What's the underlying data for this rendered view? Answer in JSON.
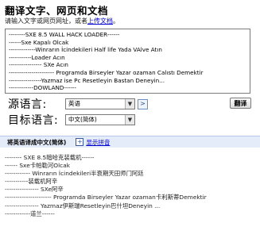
{
  "title": "翻译文字、网页和文档",
  "instructions": {
    "prefix": "请输入文字或网页网址，或者",
    "link": "上传文档",
    "suffix": "。"
  },
  "source_lines": [
    "--------SXE 8.5 WALL HACK LOADER------",
    "------Sxe Kapalı Olcak",
    "-------------Winrarın İcindekileri Half life Yada VAlve Atın",
    "-----------Loader Acın",
    "---------------- SXe Acın",
    "---------------------- Programda Birseyler Yazar ozaman Calıstı Demektir",
    "----------------Yazmaz ise Pc Resetleyin Bastan Deneyin...",
    "------------DOWLAND------"
  ],
  "source_lang": {
    "label": "源语言:",
    "value": "英语"
  },
  "target_lang": {
    "label": "目标语言:",
    "value": "中文(简体)"
  },
  "swap_icon": "swap-icon",
  "translate_button": "翻译",
  "result_bar": {
    "title": "将英语译成中文(简体)",
    "link": "显示拼音"
  },
  "output_lines": [
    "-------- SXE 8.5暗哈克装载机------",
    "------ Sxe卡帕勒河Olcak",
    "------------ Winrarın İcindekileri半衰期天田师门阿廷",
    "-----------装载机阿辛",
    "---------------- SXe阿辛",
    "---------------------- Programda Birseyler Yazar ozaman卡利斯蒂Demektir",
    "---------------- Yazmaz伊斯瑞Resetleyin巴什坦Deneyin ...",
    "------------道兰------"
  ]
}
